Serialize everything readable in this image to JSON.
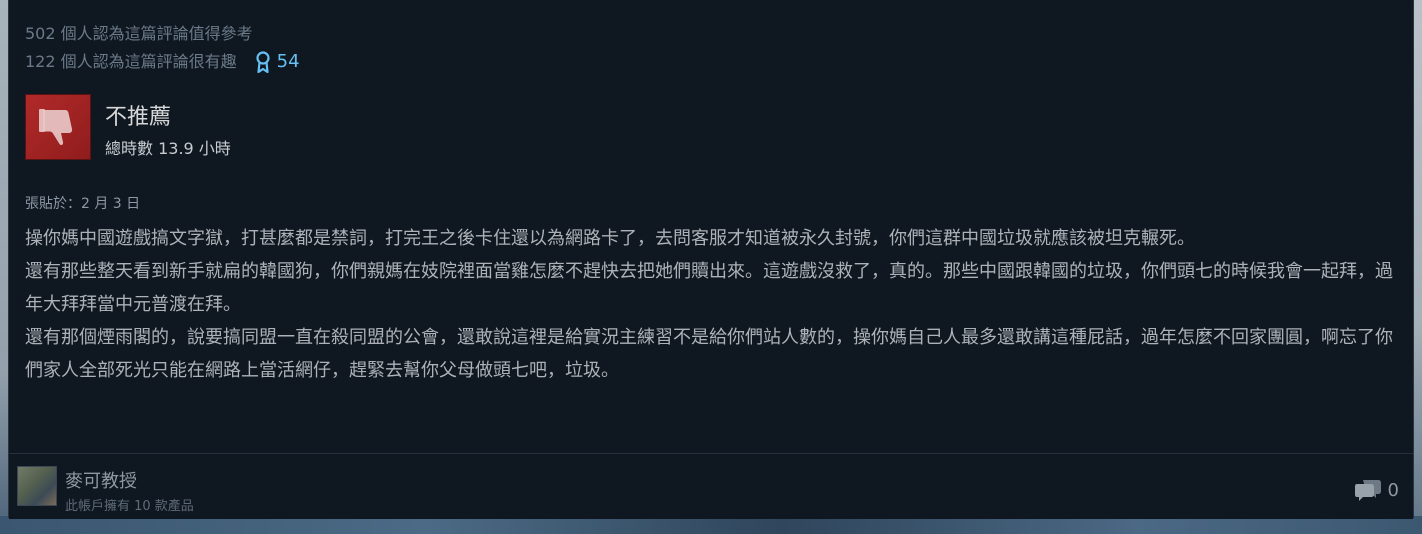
{
  "helpful": {
    "useful_text": "502 個人認為這篇評論值得參考",
    "funny_text": "122 個人認為這篇評論很有趣",
    "award_count": "54"
  },
  "verdict": {
    "title": "不推薦",
    "hours": "總時數 13.9 小時",
    "icon": "thumbs-down-icon",
    "color": "#b22a2a"
  },
  "review": {
    "posted": "張貼於：2 月 3 日",
    "paragraphs": [
      "操你媽中國遊戲搞文字獄，打甚麼都是禁詞，打完王之後卡住還以為網路卡了，去問客服才知道被永久封號，你們這群中國垃圾就應該被坦克輾死。",
      "還有那些整天看到新手就扁的韓國狗，你們親媽在妓院裡面當雞怎麼不趕快去把她們贖出來。這遊戲沒救了，真的。那些中國跟韓國的垃圾，你們頭七的時候我會一起拜，過年大拜拜當中元普渡在拜。",
      "還有那個煙雨閣的，說要搞同盟一直在殺同盟的公會，還敢說這裡是給實況主練習不是給你們站人數的，操你媽自己人最多還敢講這種屁話，過年怎麼不回家團圓，啊忘了你們家人全部死光只能在網路上當活網仔，趕緊去幫你父母做頭七吧，垃圾。"
    ]
  },
  "author": {
    "name": "麥可教授",
    "owns": "此帳戶擁有 10 款產品",
    "comment_count": "0"
  }
}
